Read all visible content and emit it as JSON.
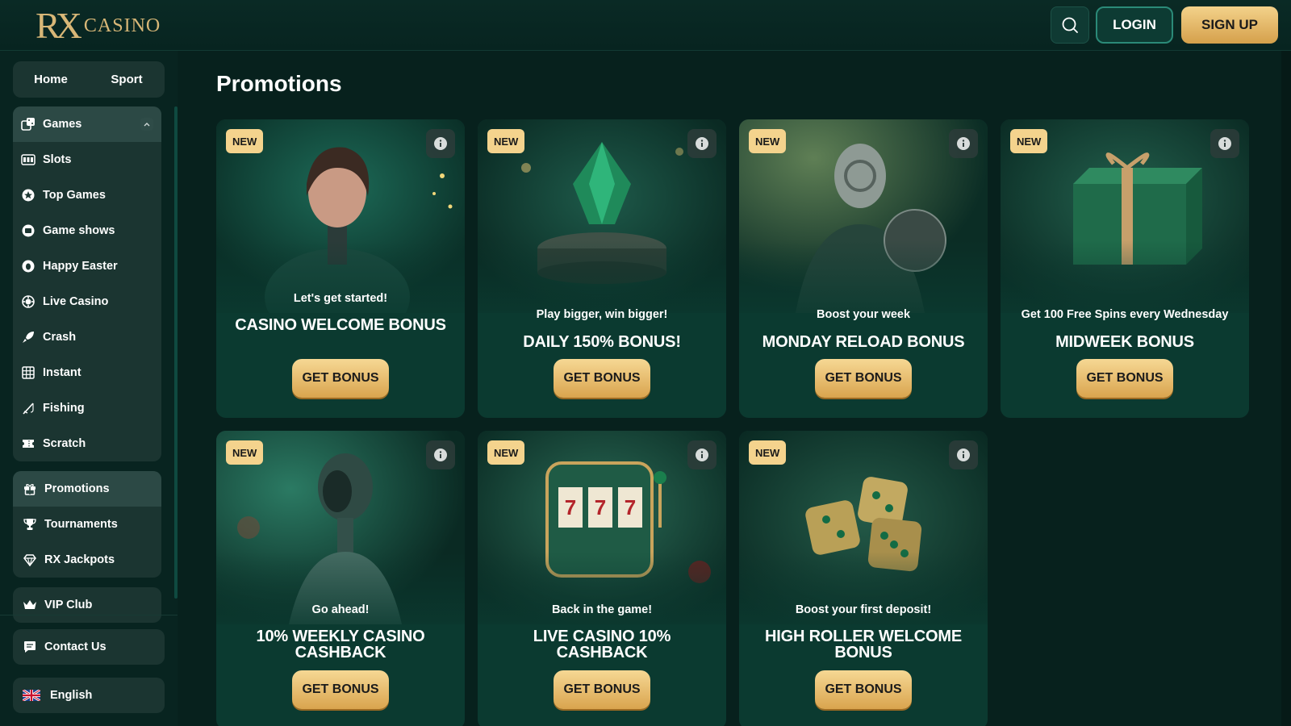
{
  "header": {
    "logo_mark": "RX",
    "logo_text": "CASINO",
    "login_label": "LOGIN",
    "signup_label": "SIGN UP"
  },
  "sidebar": {
    "top_tabs": [
      "Home",
      "Sport"
    ],
    "games_group": {
      "label": "Games",
      "items": [
        {
          "label": "Slots",
          "icon": "slot-machine-icon"
        },
        {
          "label": "Top Games",
          "icon": "star-icon"
        },
        {
          "label": "Game shows",
          "icon": "tv-icon"
        },
        {
          "label": "Happy Easter",
          "icon": "egg-icon"
        },
        {
          "label": "Live Casino",
          "icon": "chip-icon"
        },
        {
          "label": "Crash",
          "icon": "rocket-icon"
        },
        {
          "label": "Instant",
          "icon": "grid-icon"
        },
        {
          "label": "Fishing",
          "icon": "fishing-rod-icon"
        },
        {
          "label": "Scratch",
          "icon": "ticket-icon"
        }
      ]
    },
    "promo_group": [
      {
        "label": "Promotions",
        "icon": "gift-icon",
        "active": true
      },
      {
        "label": "Tournaments",
        "icon": "trophy-icon"
      },
      {
        "label": "RX Jackpots",
        "icon": "diamond-icon"
      }
    ],
    "vip_label": "VIP Club",
    "contact_label": "Contact Us",
    "language_label": "English"
  },
  "main": {
    "title": "Promotions",
    "cards": [
      {
        "badge": "NEW",
        "subtitle": "Let's get started!",
        "title": "CASINO WELCOME BONUS",
        "button": "GET BONUS"
      },
      {
        "badge": "NEW",
        "subtitle": "Play bigger, win bigger!",
        "title": "DAILY 150% BONUS!",
        "button": "GET BONUS"
      },
      {
        "badge": "NEW",
        "subtitle": "Boost your week",
        "title": "MONDAY RELOAD BONUS",
        "button": "GET BONUS"
      },
      {
        "badge": "NEW",
        "subtitle": "Get 100 Free Spins every Wednesday",
        "title": "MIDWEEK BONUS",
        "button": "GET BONUS"
      },
      {
        "badge": "NEW",
        "subtitle": "Go ahead!",
        "title": "10% WEEKLY CASINO CASHBACK",
        "button": "GET BONUS"
      },
      {
        "badge": "NEW",
        "subtitle": "Back in the game!",
        "title": "LIVE CASINO 10% CASHBACK",
        "button": "GET BONUS"
      },
      {
        "badge": "NEW",
        "subtitle": "Boost your first deposit!",
        "title": "HIGH ROLLER WELCOME BONUS",
        "button": "GET BONUS"
      }
    ]
  },
  "colors": {
    "background": "#07211d",
    "card": "#0b3a30",
    "gold": "#f0cf88",
    "accent_teal": "#2b8a78"
  }
}
